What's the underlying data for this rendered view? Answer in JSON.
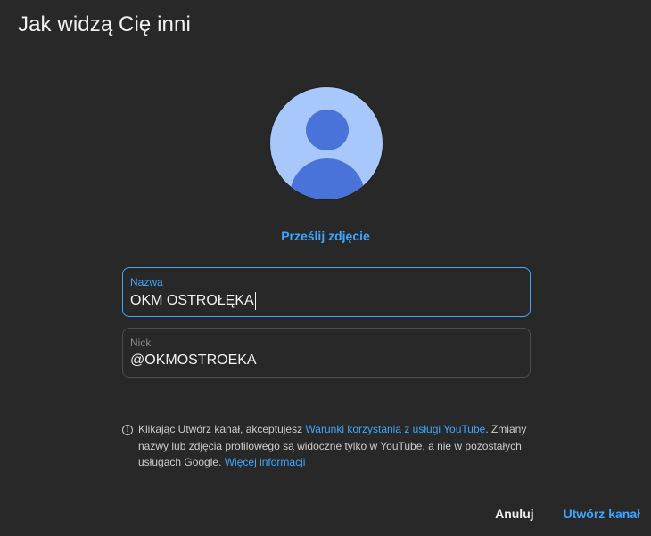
{
  "dialog": {
    "title": "Jak widzą Cię inni"
  },
  "avatar": {
    "icon": "default-avatar-icon",
    "bg_color": "#a8c7fa",
    "fg_color": "#4a73d9"
  },
  "upload": {
    "label": "Prześlij zdjęcie"
  },
  "name_field": {
    "label": "Nazwa",
    "value": "OKM OSTROŁĘKA"
  },
  "nick_field": {
    "label": "Nick",
    "value": "@OKMOSTROEKA"
  },
  "notice": {
    "icon": "info-icon",
    "text_before": "Klikając Utwórz kanał, akceptujesz ",
    "terms_link": "Warunki korzystania z usługi YouTube",
    "text_middle": ". Zmiany nazwy lub zdjęcia profilowego są widoczne tylko w YouTube, a nie w pozostałych usługach Google. ",
    "more_link": "Więcej informacji"
  },
  "actions": {
    "cancel_label": "Anuluj",
    "create_label": "Utwórz kanał"
  },
  "colors": {
    "accent": "#3ea6ff",
    "background": "#282828",
    "text": "#f1f1f1"
  }
}
